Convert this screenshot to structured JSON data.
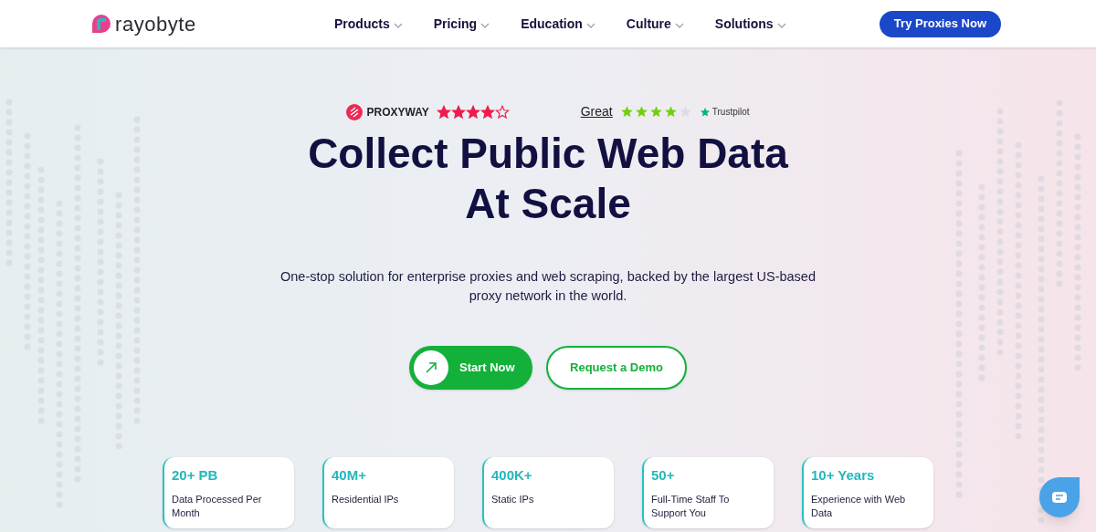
{
  "header": {
    "logo": "rayobyte",
    "nav": [
      {
        "label": "Products"
      },
      {
        "label": "Pricing"
      },
      {
        "label": "Education"
      },
      {
        "label": "Culture"
      },
      {
        "label": "Solutions"
      }
    ],
    "cta": "Try Proxies Now"
  },
  "ratings": {
    "proxyway": {
      "name": "PROXYWAY",
      "stars": 4
    },
    "trustpilot": {
      "verdict": "Great",
      "stars": 4,
      "name": "Trustpilot"
    }
  },
  "hero": {
    "title_lines": [
      "Collect Public Web Data",
      "At Scale"
    ],
    "subtitle": "One-stop solution for enterprise proxies and web scraping, backed by the largest US-based proxy network in the world.",
    "buttons": [
      {
        "kind": "primary",
        "label": "Start Now"
      },
      {
        "kind": "outline",
        "label": "Request a Demo"
      }
    ]
  },
  "stats": [
    {
      "value": "20+ PB",
      "label": "Data Processed Per Month"
    },
    {
      "value": "40M+",
      "label": "Residential IPs"
    },
    {
      "value": "400K+",
      "label": "Static IPs"
    },
    {
      "value": "50+",
      "label": "Full-Time Staff To Support You"
    },
    {
      "value": "10+ Years",
      "label": "Experience with Web Data"
    }
  ]
}
